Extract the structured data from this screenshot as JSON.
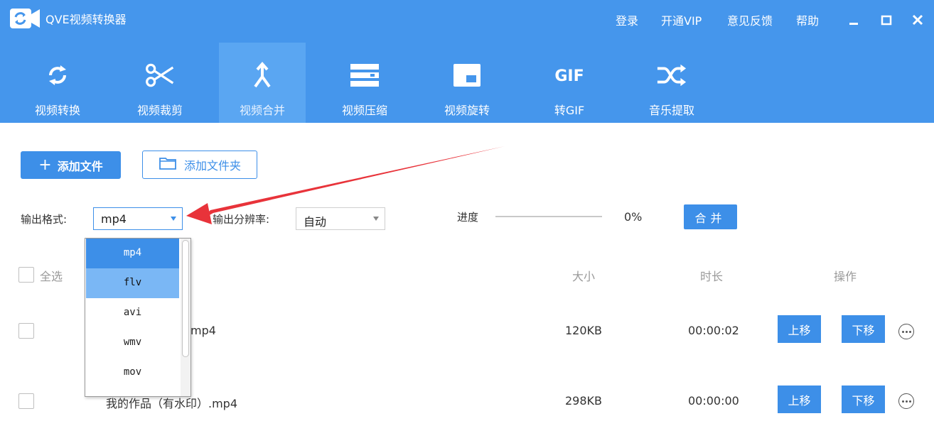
{
  "window": {
    "title": "QVE视频转换器",
    "links": [
      "登录",
      "开通VIP",
      "意见反馈",
      "帮助"
    ],
    "controls": [
      "minimize-icon",
      "maximize-icon",
      "close-icon"
    ]
  },
  "tabs": [
    {
      "label": "视频转换",
      "icon": "convert-icon",
      "active": false
    },
    {
      "label": "视频裁剪",
      "icon": "scissors-icon",
      "active": false
    },
    {
      "label": "视频合并",
      "icon": "merge-icon",
      "active": true
    },
    {
      "label": "视频压缩",
      "icon": "compress-icon",
      "active": false
    },
    {
      "label": "视频旋转",
      "icon": "rotate-icon",
      "active": false
    },
    {
      "label": "转GIF",
      "icon": "gif-icon",
      "active": false
    },
    {
      "label": "音乐提取",
      "icon": "shuffle-icon",
      "active": false
    }
  ],
  "toolbar": {
    "add_file_icon": "+",
    "add_file": "添加文件",
    "add_folder": "添加文件夹"
  },
  "output": {
    "format_label": "输出格式:",
    "format_value": "mp4",
    "resolution_label": "输出分辨率:",
    "resolution_value": "自动",
    "progress_label": "进度",
    "progress_percent": "0%",
    "progress_value": 0,
    "merge_button": "合并"
  },
  "list": {
    "select_all": "全选",
    "headers": {
      "size": "大小",
      "duration": "时长",
      "actions": "操作"
    },
    "rows": [
      {
        "name": "mp4",
        "size": "120KB",
        "duration": "00:00:02",
        "up": "上移",
        "down": "下移"
      },
      {
        "name": "我的作品（有水印）.mp4",
        "size": "298KB",
        "duration": "00:00:00",
        "up": "上移",
        "down": "下移"
      }
    ]
  },
  "format_dropdown": {
    "options": [
      "mp4",
      "flv",
      "avi",
      "wmv",
      "mov"
    ],
    "selected": "mp4",
    "highlighted": "flv"
  },
  "colors": {
    "header_bg": "#4596ec",
    "active_tab": "#5aa6f2",
    "accent": "#3d8fe8",
    "arrow": "#e8333a"
  }
}
